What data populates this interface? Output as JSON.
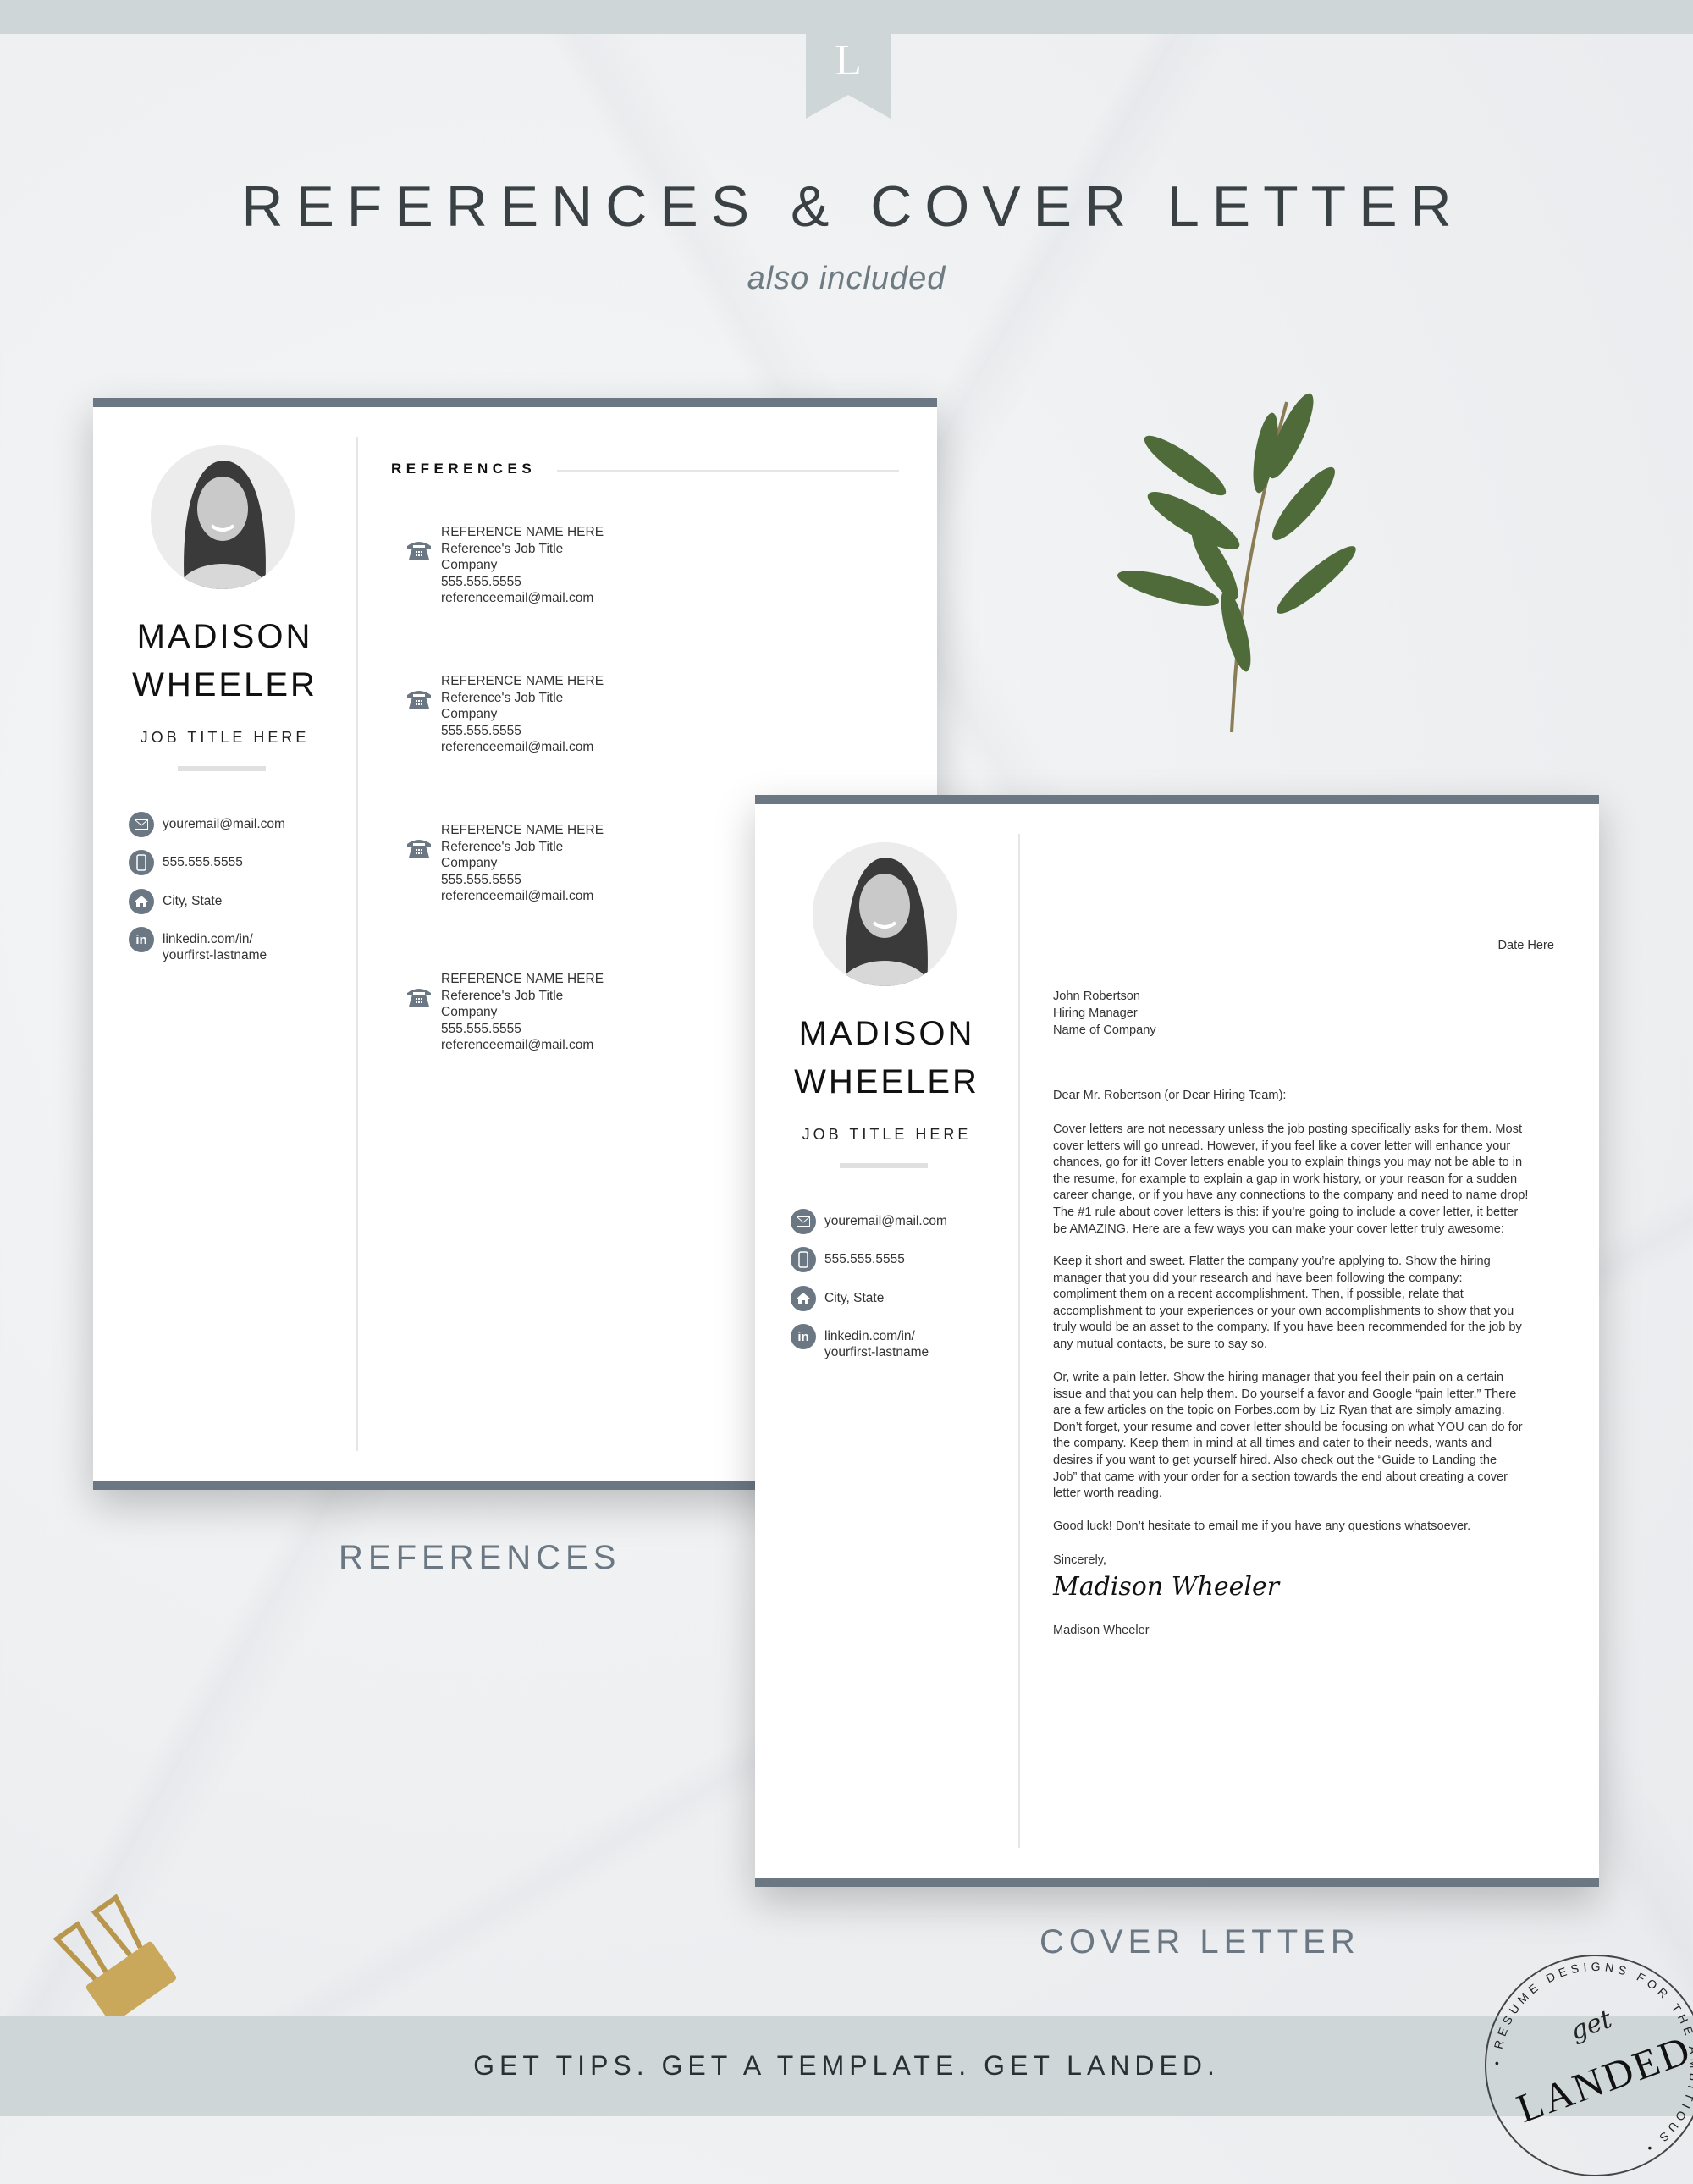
{
  "header": {
    "logo_letter": "L",
    "title": "REFERENCES & COVER LETTER",
    "subtitle": "also included"
  },
  "colors": {
    "accent": "#6b7884",
    "band": "#cfd6d8",
    "title": "#3a4145"
  },
  "profile": {
    "first": "MADISON",
    "last": "WHEELER",
    "job_title": "JOB TITLE HERE",
    "contacts": [
      {
        "icon": "envelope-icon",
        "text": [
          "youremail@mail.com"
        ]
      },
      {
        "icon": "mobile-phone-icon",
        "text": [
          "555.555.5555"
        ]
      },
      {
        "icon": "home-icon",
        "text": [
          "City, State"
        ]
      },
      {
        "icon": "linkedin-icon",
        "text": [
          "linkedin.com/in/",
          "yourfirst-lastname"
        ]
      }
    ]
  },
  "references_page": {
    "heading": "REFERENCES",
    "label": "REFERENCES",
    "entries": [
      {
        "name": "REFERENCE NAME HERE",
        "title": "Reference's Job Title",
        "company": "Company",
        "phone": "555.555.5555",
        "email": "referenceemail@mail.com"
      },
      {
        "name": "REFERENCE NAME HERE",
        "title": "Reference's Job Title",
        "company": "Company",
        "phone": "555.555.5555",
        "email": "referenceemail@mail.com"
      },
      {
        "name": "REFERENCE NAME HERE",
        "title": "Reference's Job Title",
        "company": "Company",
        "phone": "555.555.5555",
        "email": "referenceemail@mail.com"
      },
      {
        "name": "REFERENCE NAME HERE",
        "title": "Reference's Job Title",
        "company": "Company",
        "phone": "555.555.5555",
        "email": "referenceemail@mail.com"
      }
    ]
  },
  "cover_letter": {
    "label": "COVER LETTER",
    "date": "Date Here",
    "recipient": [
      "John Robertson",
      "Hiring Manager",
      "Name of Company"
    ],
    "salutation": "Dear Mr. Robertson (or Dear Hiring Team):",
    "paragraphs": [
      [
        "Cover letters are not necessary unless the job posting specifically asks for them.  Most",
        "cover letters will go unread.  However, if you feel like a cover letter will enhance your",
        "chances, go for it!  Cover letters enable you to explain things you may not be able to in",
        "the resume, for example to explain a gap in work history, or your reason for a sudden",
        "career change, or if you have any connections to the company and need to name drop!",
        "The #1 rule about cover letters is this: if you’re going to include a cover letter, it better",
        "be AMAZING.  Here are a few ways you can make your cover letter truly awesome:"
      ],
      [
        "Keep it short and sweet.  Flatter the company you’re applying to.  Show the hiring",
        "manager that you did your research and have been following the company:",
        "compliment them on a recent accomplishment.  Then, if possible, relate that",
        "accomplishment to your experiences or your own accomplishments to show that you",
        "truly would be an asset to the company.  If you have been recommended for the job by",
        "any mutual contacts, be sure to say so."
      ],
      [
        "Or, write a pain letter.  Show the hiring manager that you feel their pain on a certain",
        "issue and that you can help them.  Do yourself a favor and Google “pain letter.”  There",
        "are a few articles on the topic on Forbes.com by Liz Ryan that are simply amazing.",
        "Don’t forget, your resume and cover letter should be focusing on what YOU can do for",
        "the company.  Keep them in mind at all times and cater to their needs, wants and",
        "desires if you want to get yourself hired.  Also check out the “Guide to Landing the",
        "Job” that came with your order for a section towards the end about creating a cover",
        "letter worth reading."
      ],
      [
        "Good luck!  Don’t hesitate to email me if you have any questions whatsoever."
      ]
    ],
    "closing": "Sincerely,",
    "signature": "Madison Wheeler",
    "signed_name": "Madison Wheeler"
  },
  "footer": {
    "tagline": "GET TIPS. GET A TEMPLATE. GET LANDED.",
    "stamp": {
      "ring_text": "• RESUME DESIGNS FOR THE AMBITIOUS •",
      "script": "get",
      "word": "LANDED"
    }
  }
}
